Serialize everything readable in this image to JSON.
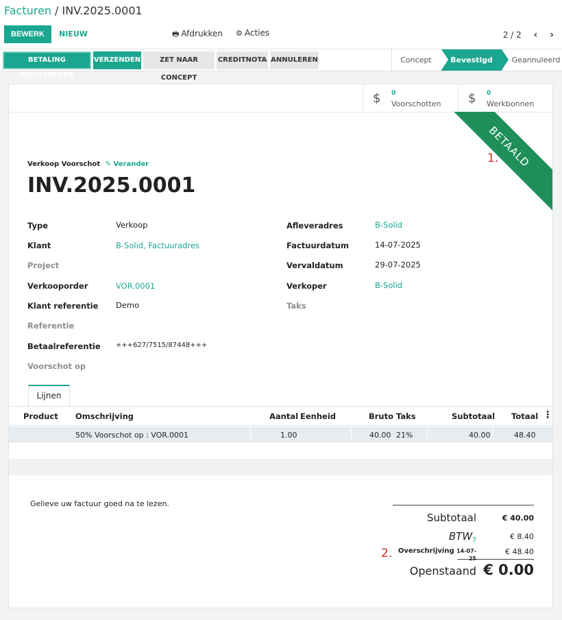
{
  "breadcrumb": {
    "parent": "Facturen",
    "separator": " / ",
    "current": "INV.2025.0001"
  },
  "toolbar": {
    "edit_label": "BEWERK",
    "new_label": "NIEUW",
    "print_label": "Afdrukken",
    "actions_label": "Acties",
    "pager": "2 / 2",
    "prev_glyph": "‹",
    "next_glyph": "›"
  },
  "statusbar": {
    "buttons": [
      "BETALING REGISTREREN",
      "VERZENDEN",
      "ZET NAAR CONCEPT",
      "CREDITNOTA",
      "ANNULEREN"
    ],
    "stages": [
      "Concept",
      "Bevestigd",
      "Geannuleerd"
    ],
    "active_stage": "Bevestigd"
  },
  "smart_buttons": [
    {
      "count": "0",
      "label": "Voorschotten",
      "icon": "dollar-icon"
    },
    {
      "count": "0",
      "label": "Werkbonnen",
      "icon": "dollar-icon"
    }
  ],
  "ribbon": {
    "label": "BETAALD",
    "color": "#1f8f5a"
  },
  "annotations": {
    "first": "1.",
    "second": "2."
  },
  "document": {
    "kind": "Verkoop Voorschot",
    "edit_link": "Verander",
    "number": "INV.2025.0001"
  },
  "fields_left": [
    {
      "label": "Type",
      "value": "Verkoop",
      "link": false,
      "muted": false
    },
    {
      "label": "Klant",
      "value": "B-Solid, Factuuradres",
      "link": true,
      "muted": false
    },
    {
      "label": "Project",
      "value": "",
      "link": false,
      "muted": true
    },
    {
      "label": "Verkooporder",
      "value": "VOR.0001",
      "link": true,
      "muted": false
    },
    {
      "label": "Klant referentie",
      "value": "Demo",
      "link": false,
      "muted": false
    },
    {
      "label": "Referentie",
      "value": "",
      "link": false,
      "muted": true
    },
    {
      "label": "Betaalreferentie",
      "value": "+++627/7515/87448+++",
      "link": false,
      "muted": false
    },
    {
      "label": "Voorschot op",
      "value": "",
      "link": false,
      "muted": true
    }
  ],
  "fields_right": [
    {
      "label": "Afleveradres",
      "value": "B-Solid",
      "link": true,
      "muted": false
    },
    {
      "label": "Factuurdatum",
      "value": "14-07-2025",
      "link": false,
      "muted": false
    },
    {
      "label": "Vervaldatum",
      "value": "29-07-2025",
      "link": false,
      "muted": false
    },
    {
      "label": "Verkoper",
      "value": "B-Solid",
      "link": true,
      "muted": false
    },
    {
      "label": "Taks",
      "value": "",
      "link": false,
      "muted": true
    }
  ],
  "tabs": [
    {
      "label": "Lijnen"
    }
  ],
  "lines_table": {
    "headers": {
      "product": "Product",
      "description": "Omschrijving",
      "quantity": "Aantal",
      "unit": "Eenheid",
      "gross": "Bruto",
      "tax": "Taks",
      "subtotal": "Subtotaal",
      "total": "Totaal",
      "menu_glyph": "⋮"
    },
    "rows": [
      {
        "product": "",
        "description": "50% Voorschot op : VOR.0001",
        "quantity": "1.00",
        "unit": "",
        "gross": "40.00",
        "tax": "21%",
        "subtotal": "40.00",
        "total": "48.40"
      }
    ]
  },
  "note": "Gelieve uw factuur goed na te lezen.",
  "totals": {
    "subtotal_label": "Subtotaal",
    "subtotal_value": "€ 40.00",
    "tax_label": "BTW",
    "tax_help": "?",
    "tax_value": "€ 8.40",
    "payment_label": "Overschrijving",
    "payment_date": "14-07-25",
    "payment_value": "€ 48.40",
    "due_label": "Openstaand",
    "due_value": "€ 0.00"
  },
  "colors": {
    "accent": "#1aa68f",
    "ribbon": "#1f8f5a",
    "annotation": "#d62828"
  }
}
